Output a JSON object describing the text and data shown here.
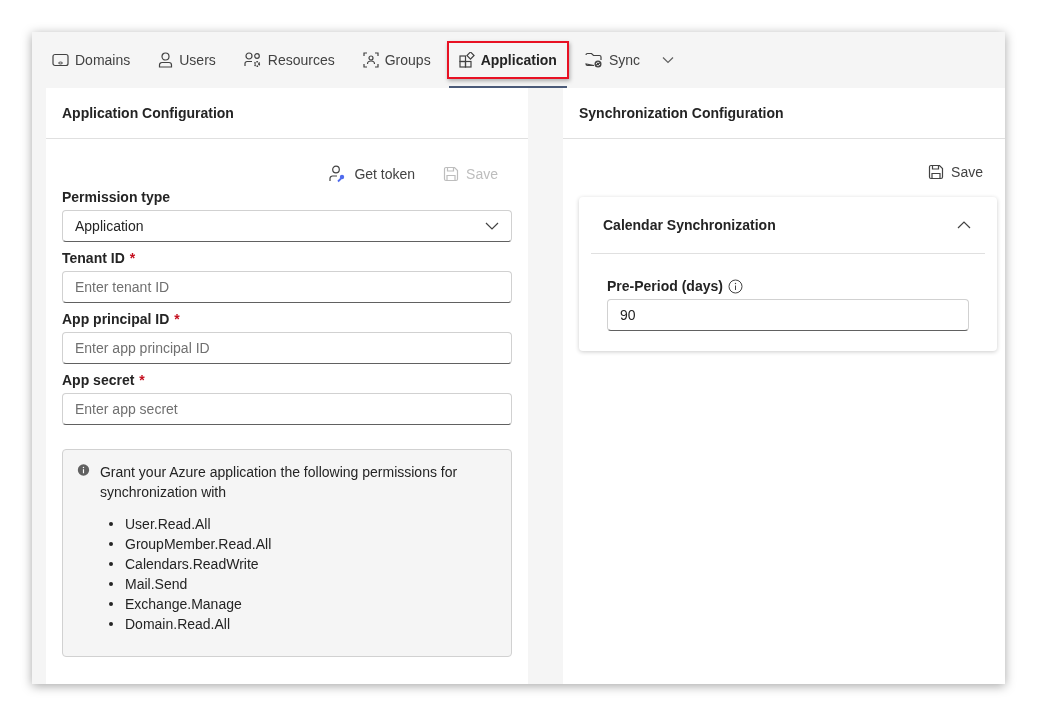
{
  "tabs": [
    {
      "label": "Domains",
      "selected": false,
      "highlighted": false
    },
    {
      "label": "Users",
      "selected": false,
      "highlighted": false
    },
    {
      "label": "Resources",
      "selected": false,
      "highlighted": false
    },
    {
      "label": "Groups",
      "selected": false,
      "highlighted": false
    },
    {
      "label": "Application",
      "selected": true,
      "highlighted": true
    },
    {
      "label": "Sync",
      "selected": false,
      "highlighted": false
    }
  ],
  "application_config": {
    "title": "Application Configuration",
    "toolbar": [
      {
        "label": "Get token",
        "kind": "token",
        "disabled": false
      },
      {
        "label": "Save",
        "kind": "save",
        "disabled": true
      }
    ],
    "fields": [
      {
        "label": "Permission type",
        "kind": "select",
        "value": "Application"
      },
      {
        "label": "Tenant ID",
        "kind": "text",
        "required_mark": "*",
        "placeholder": "Enter tenant ID"
      },
      {
        "label": "App principal ID",
        "kind": "text",
        "required_mark": "*",
        "placeholder": "Enter app principal ID"
      },
      {
        "label": "App secret",
        "kind": "text",
        "required_mark": "*",
        "placeholder": "Enter app secret"
      }
    ],
    "info": {
      "text": "Grant your Azure application the following permissions for synchronization with",
      "items": [
        "User.Read.All",
        "GroupMember.Read.All",
        "Calendars.ReadWrite",
        "Mail.Send",
        "Exchange.Manage",
        "Domain.Read.All"
      ]
    }
  },
  "sync_config": {
    "title": "Synchronization Configuration",
    "toolbar": [
      {
        "label": "Save",
        "kind": "save",
        "disabled": false
      }
    ],
    "section": {
      "title": "Calendar Synchronization",
      "expanded": true,
      "field": {
        "label": "Pre-Period (days)",
        "value": "90"
      }
    }
  }
}
